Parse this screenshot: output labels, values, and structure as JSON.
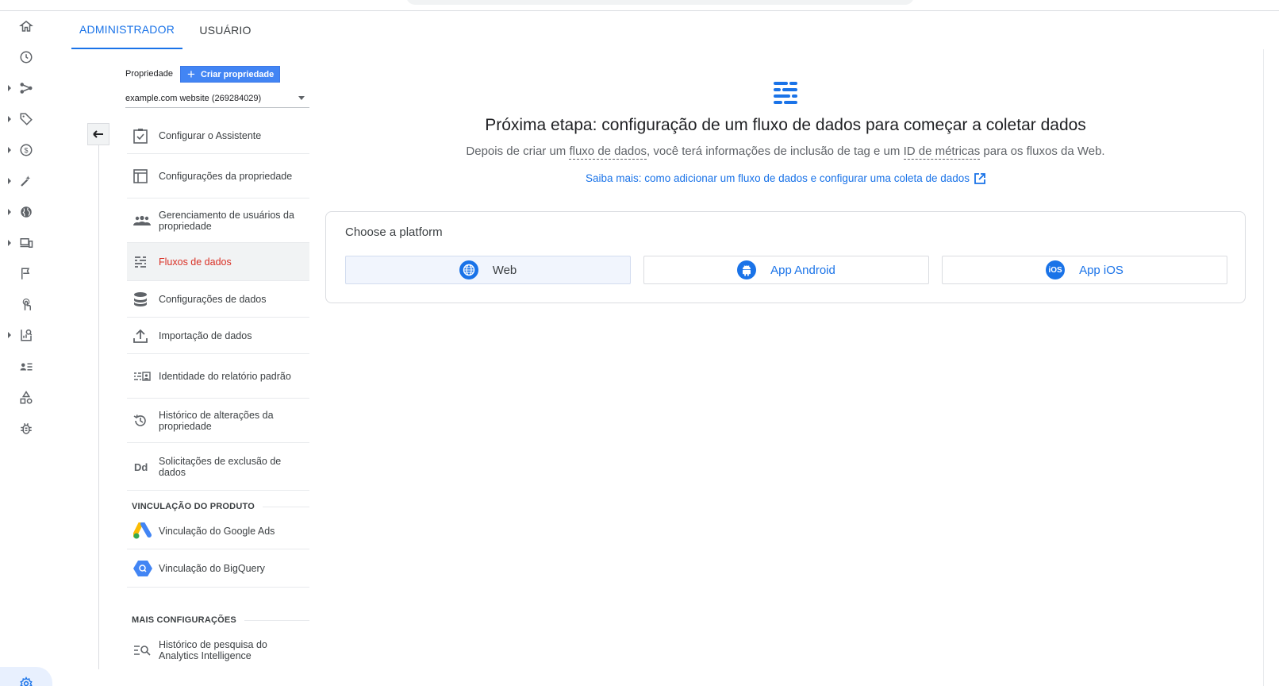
{
  "tabs": [
    {
      "label": "ADMINISTRADOR",
      "active": true
    },
    {
      "label": "USUÁRIO",
      "active": false
    }
  ],
  "rail": {
    "icons": [
      "home-icon",
      "clock-icon",
      "flow-icon",
      "tag-icon",
      "dollar-icon",
      "wand-icon",
      "globe-icon",
      "devices-icon",
      "flag-icon",
      "touch-icon",
      "report-search-icon",
      "users-list-icon",
      "shapes-icon",
      "bug-icon"
    ],
    "bottom_icon": "gear-icon"
  },
  "property": {
    "label": "Propriedade",
    "create_button": "Criar propriedade",
    "selected": "example.com website (269284029)"
  },
  "nav": {
    "items": [
      {
        "label": "Configurar o Assistente",
        "icon": "checklist-icon"
      },
      {
        "label": "Configurações da propriedade",
        "icon": "layout-icon"
      },
      {
        "label": "Gerenciamento de usuários da propriedade",
        "icon": "people-icon"
      },
      {
        "label": "Fluxos de dados",
        "icon": "streams-icon",
        "active": true
      },
      {
        "label": "Configurações de dados",
        "icon": "database-icon"
      },
      {
        "label": "Importação de dados",
        "icon": "upload-icon"
      },
      {
        "label": "Identidade do relatório padrão",
        "icon": "identity-icon"
      },
      {
        "label": "Histórico de alterações da propriedade",
        "icon": "history-icon"
      },
      {
        "label": "Solicitações de exclusão de dados",
        "icon": "dd-icon"
      }
    ],
    "section_product": "VINCULAÇÃO DO PRODUTO",
    "product_items": [
      {
        "label": "Vinculação do Google Ads",
        "icon": "google-ads-icon"
      },
      {
        "label": "Vinculação do BigQuery",
        "icon": "bigquery-icon"
      }
    ],
    "section_more": "MAIS CONFIGURAÇÕES",
    "more_items": [
      {
        "label": "Histórico de pesquisa do Analytics Intelligence",
        "icon": "search-history-icon"
      }
    ]
  },
  "main": {
    "headline": "Próxima etapa: configuração de um fluxo de dados para começar a coletar dados",
    "sub_pre": "Depois de criar um ",
    "sub_term1": "fluxo de dados",
    "sub_mid": ", você terá informações de inclusão de tag e um ",
    "sub_term2": "ID de métricas",
    "sub_post": " para os fluxos da Web.",
    "learn_more": "Saiba mais: como adicionar um fluxo de dados e configurar uma coleta de dados",
    "platform_title": "Choose a platform",
    "platforms": [
      {
        "label": "Web",
        "icon": "globe-icon",
        "selected": true
      },
      {
        "label": "App Android",
        "icon": "android-icon",
        "selected": false
      },
      {
        "label": "App iOS",
        "icon": "ios-icon",
        "selected": false
      }
    ]
  },
  "colors": {
    "accent": "#1a73e8",
    "active_nav_text": "#d93025",
    "create_button": "#4285f4"
  }
}
